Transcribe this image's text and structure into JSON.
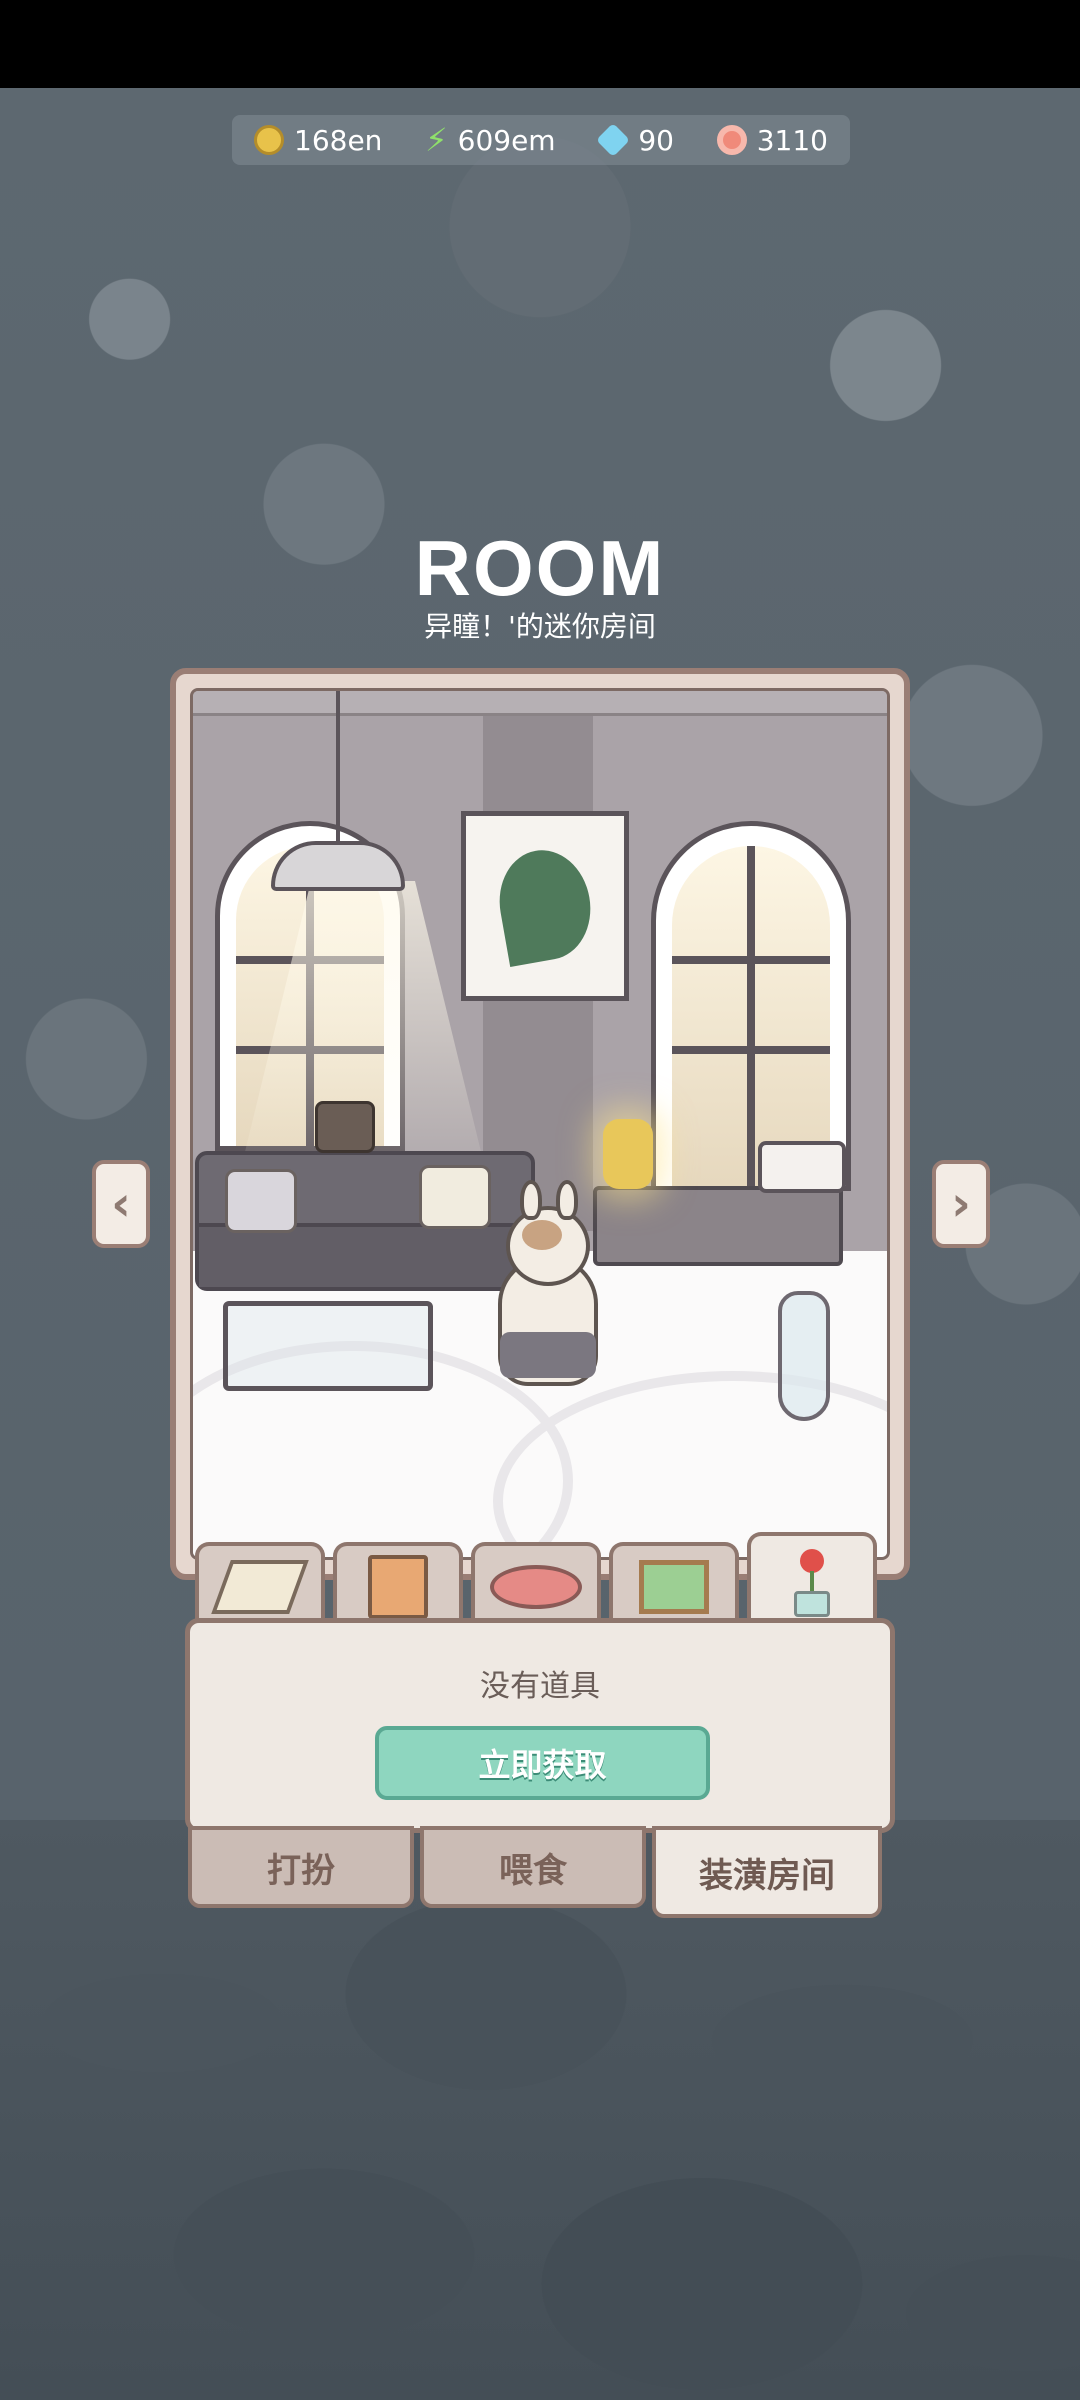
{
  "currency": {
    "coins": "168en",
    "energy": "609em",
    "gems": "90",
    "hearts": "3110"
  },
  "header": {
    "title": "ROOM",
    "subtitle": "异瞳！'的迷你房间"
  },
  "inventory": {
    "categories": [
      {
        "icon": "floor-tile-icon"
      },
      {
        "icon": "wallpaper-icon"
      },
      {
        "icon": "rug-icon"
      },
      {
        "icon": "picture-frame-icon"
      },
      {
        "icon": "potted-flower-icon"
      }
    ],
    "empty_message": "没有道具",
    "get_button": "立即获取"
  },
  "bottom_tabs": {
    "dress_up": "打扮",
    "feed": "喂食",
    "decorate_room": "装潢房间"
  },
  "colors": {
    "accent_green": "#8ed6bf",
    "frame_brown": "#9a7e75"
  }
}
